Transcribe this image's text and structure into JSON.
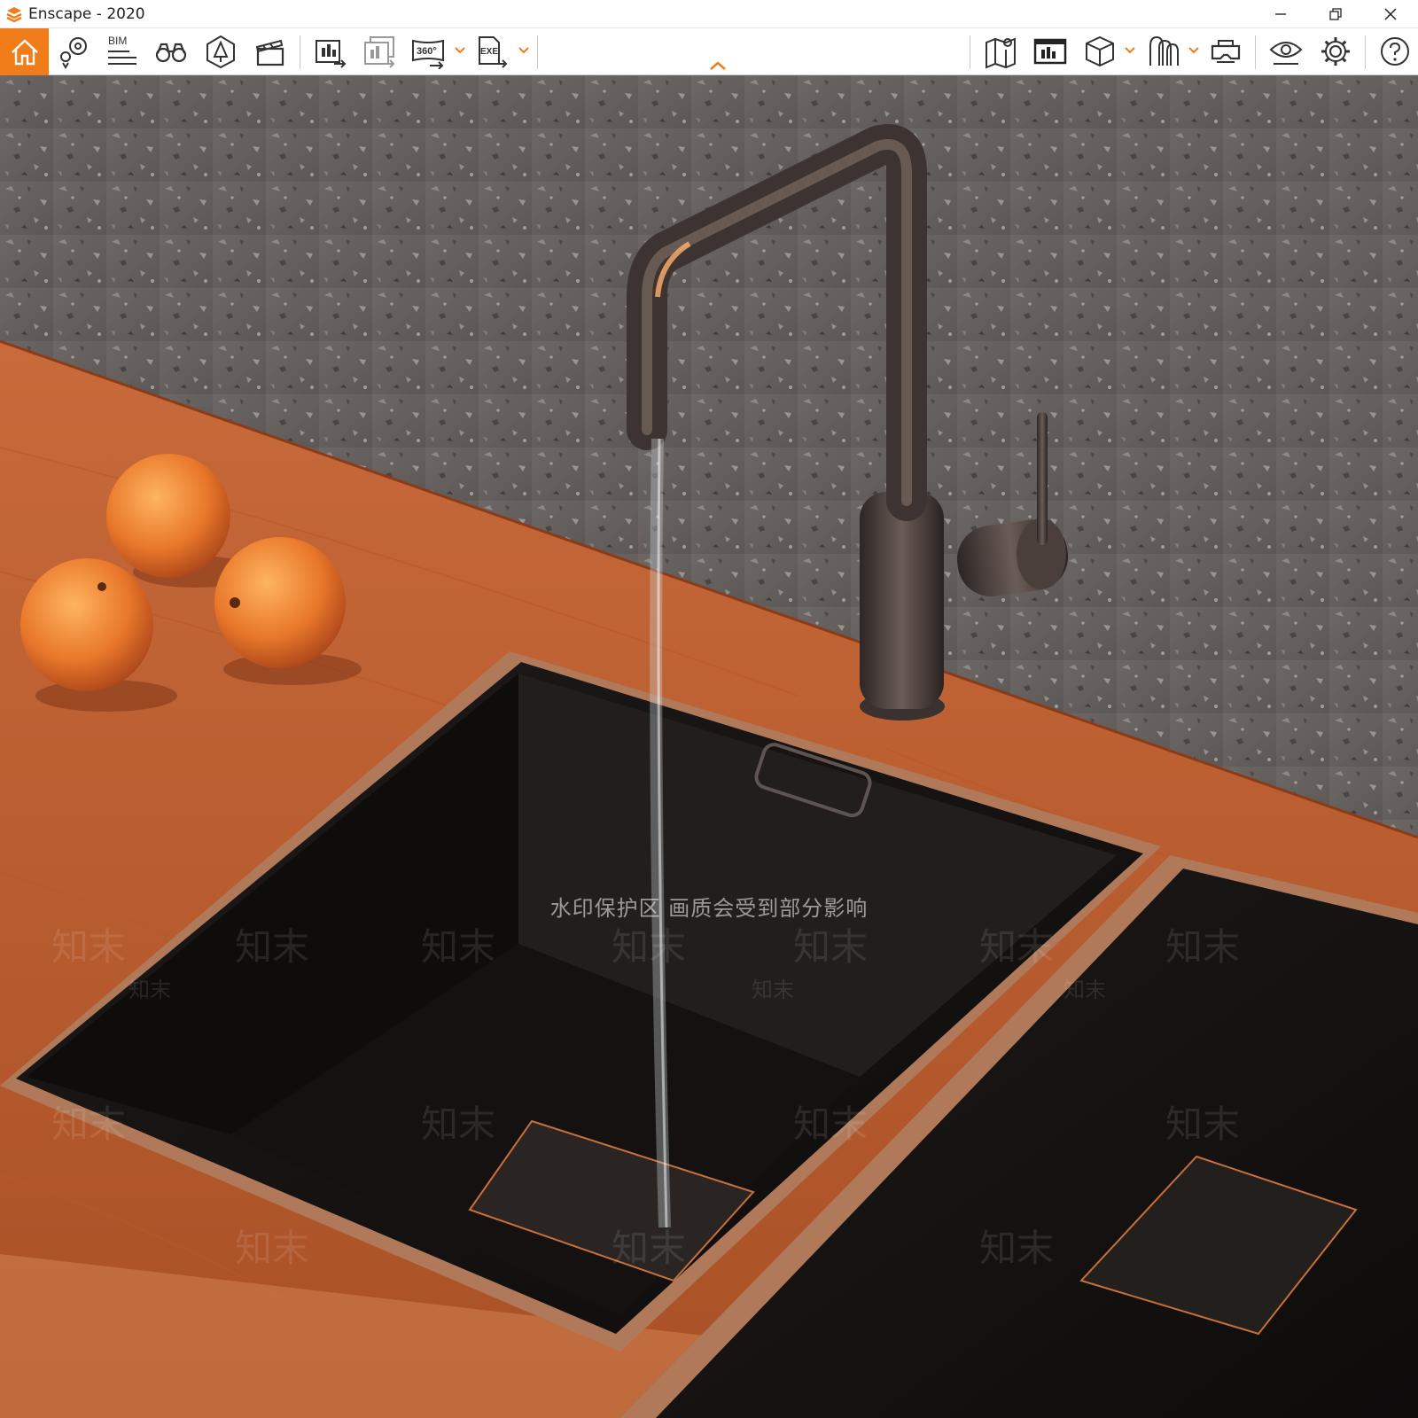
{
  "window": {
    "title": "Enscape - 2020",
    "accent_color": "#f07d19",
    "controls": [
      "minimize-icon",
      "restore-icon",
      "close-icon"
    ]
  },
  "toolbar": {
    "bim_label": "BIM",
    "panorama_label": "360°",
    "exe_label": "EXE",
    "left_tools": [
      "home-icon",
      "views-icon",
      "bim-icon",
      "binoculars-icon",
      "site-context-icon",
      "video-editor-icon",
      "screenshot-export-icon",
      "batch-render-icon",
      "panorama-icon",
      "exe-export-icon"
    ],
    "right_tools": [
      "map-icon",
      "render-window-icon",
      "asset-library-icon",
      "material-editor-icon",
      "vr-headset-icon",
      "visual-settings-icon",
      "settings-icon",
      "help-icon"
    ]
  },
  "viewport": {
    "scene": "kitchen-sink-render",
    "watermark": {
      "notice": "水印保护区  画质会受到部分影响",
      "tile_text": "知末",
      "color": "#ffffff"
    }
  }
}
